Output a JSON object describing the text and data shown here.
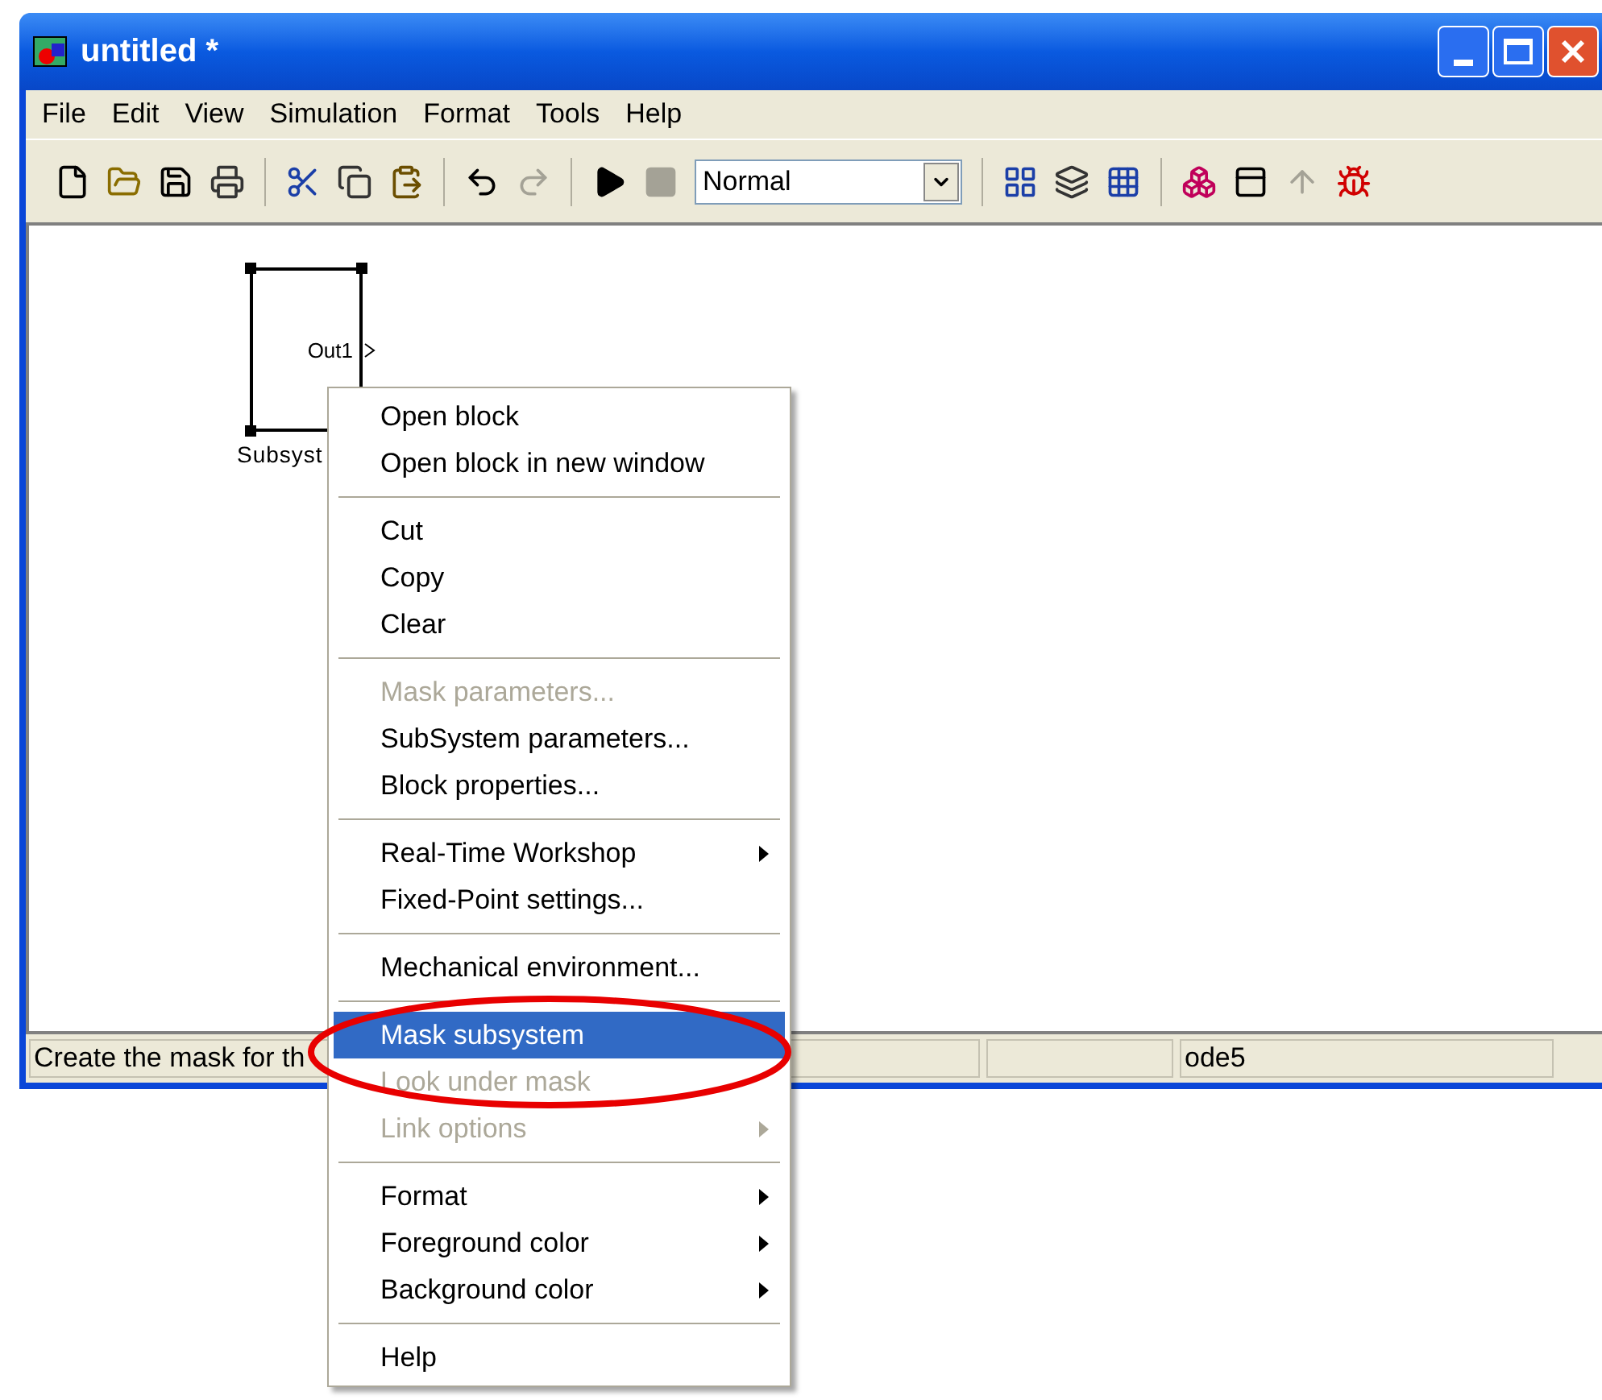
{
  "window": {
    "title": "untitled *"
  },
  "menu_bar": [
    {
      "label": "File"
    },
    {
      "label": "Edit"
    },
    {
      "label": "View"
    },
    {
      "label": "Simulation"
    },
    {
      "label": "Format"
    },
    {
      "label": "Tools"
    },
    {
      "label": "Help"
    }
  ],
  "toolbar": {
    "buttons": [
      {
        "kind": "new",
        "disabled": false
      },
      {
        "kind": "open",
        "disabled": false
      },
      {
        "kind": "save",
        "disabled": false
      },
      {
        "kind": "print",
        "disabled": false
      },
      {
        "kind": "separator"
      },
      {
        "kind": "cut",
        "disabled": false
      },
      {
        "kind": "copy",
        "disabled": false
      },
      {
        "kind": "paste",
        "disabled": false
      },
      {
        "kind": "separator"
      },
      {
        "kind": "undo",
        "disabled": false
      },
      {
        "kind": "redo",
        "disabled": true
      },
      {
        "kind": "separator"
      },
      {
        "kind": "play",
        "disabled": false
      },
      {
        "kind": "stop",
        "disabled": true
      },
      {
        "kind": "mode"
      },
      {
        "kind": "separator"
      },
      {
        "kind": "grid",
        "disabled": false
      },
      {
        "kind": "layers",
        "disabled": false
      },
      {
        "kind": "grid2",
        "disabled": false
      },
      {
        "kind": "separator"
      },
      {
        "kind": "library",
        "disabled": false
      },
      {
        "kind": "panel",
        "disabled": false
      },
      {
        "kind": "up",
        "disabled": true
      },
      {
        "kind": "debug",
        "disabled": false
      }
    ],
    "mode_dropdown": {
      "value": "Normal"
    }
  },
  "canvas": {
    "block": {
      "port_label": "Out1",
      "name": "Subsyst",
      "selected": true
    }
  },
  "context_menu": [
    {
      "kind": "item",
      "label": "Open block",
      "disabled": false,
      "selected": false
    },
    {
      "kind": "item",
      "label": "Open block in new window",
      "disabled": false,
      "selected": false
    },
    {
      "kind": "separator"
    },
    {
      "kind": "item",
      "label": "Cut",
      "disabled": false,
      "selected": false
    },
    {
      "kind": "item",
      "label": "Copy",
      "disabled": false,
      "selected": false
    },
    {
      "kind": "item",
      "label": "Clear",
      "disabled": false,
      "selected": false
    },
    {
      "kind": "separator"
    },
    {
      "kind": "item",
      "label": "Mask parameters...",
      "disabled": true,
      "selected": false
    },
    {
      "kind": "item",
      "label": "SubSystem parameters...",
      "disabled": false,
      "selected": false
    },
    {
      "kind": "item",
      "label": "Block properties...",
      "disabled": false,
      "selected": false
    },
    {
      "kind": "separator"
    },
    {
      "kind": "item",
      "label": "Real-Time Workshop",
      "disabled": false,
      "selected": false,
      "submenu": true
    },
    {
      "kind": "item",
      "label": "Fixed-Point settings...",
      "disabled": false,
      "selected": false
    },
    {
      "kind": "separator"
    },
    {
      "kind": "item",
      "label": "Mechanical environment...",
      "disabled": false,
      "selected": false
    },
    {
      "kind": "separator"
    },
    {
      "kind": "item",
      "label": "Mask subsystem",
      "disabled": false,
      "selected": true
    },
    {
      "kind": "item",
      "label": "Look under mask",
      "disabled": true,
      "selected": false
    },
    {
      "kind": "item",
      "label": "Link options",
      "disabled": true,
      "selected": false,
      "submenu": true
    },
    {
      "kind": "separator"
    },
    {
      "kind": "item",
      "label": "Format",
      "disabled": false,
      "selected": false,
      "submenu": true
    },
    {
      "kind": "item",
      "label": "Foreground color",
      "disabled": false,
      "selected": false,
      "submenu": true
    },
    {
      "kind": "item",
      "label": "Background color",
      "disabled": false,
      "selected": false,
      "submenu": true
    },
    {
      "kind": "separator"
    },
    {
      "kind": "item",
      "label": "Help",
      "disabled": false,
      "selected": false
    }
  ],
  "status_bar": {
    "message": "Create the mask for th",
    "solver": "ode5"
  }
}
